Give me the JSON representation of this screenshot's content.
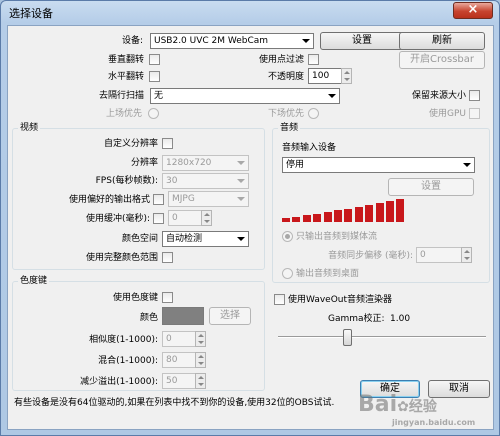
{
  "dialog": {
    "title": "选择设备",
    "close_label": "×"
  },
  "device": {
    "label": "设备:",
    "value": "USB2.0 UVC 2M WebCam",
    "config_button": "设置",
    "refresh_button": "刷新"
  },
  "flip_v": {
    "label": "垂直翻转"
  },
  "flip_h": {
    "label": "水平翻转"
  },
  "point_filter": {
    "label": "使用点过滤"
  },
  "opacity": {
    "label": "不透明度",
    "value": "100"
  },
  "crossbar_button": "开启Crossbar",
  "deinterlace": {
    "label": "去隔行扫描",
    "value": "无"
  },
  "keep_source_size": {
    "label": "保留来源大小"
  },
  "top_first": {
    "label": "上场优先"
  },
  "bottom_first": {
    "label": "下场优先"
  },
  "use_gpu": {
    "label": "使用GPU"
  },
  "video": {
    "group_label": "视频",
    "custom_resolution": {
      "label": "自定义分辨率"
    },
    "resolution": {
      "label": "分辨率",
      "value": "1280x720"
    },
    "fps": {
      "label": "FPS(每秒帧数):",
      "value": "30"
    },
    "preferred_format": {
      "label": "使用偏好的输出格式",
      "value": "MJPG"
    },
    "buffering": {
      "label": "使用缓冲(毫秒):",
      "value": "0"
    },
    "color_space": {
      "label": "颜色空间",
      "value": "自动检测"
    },
    "full_range": {
      "label": "使用完整颜色范围"
    }
  },
  "audio": {
    "group_label": "音频",
    "input_device_label": "音频输入设备",
    "input_device_value": "停用",
    "config_button": "设置",
    "meter_bars": [
      0.16,
      0.22,
      0.28,
      0.34,
      0.41,
      0.48,
      0.56,
      0.64,
      0.72,
      0.8,
      0.88,
      0.95
    ],
    "meter_color": "#c8171b",
    "output_stream_only": "只输出音频到媒体流",
    "sync_offset_label": "音频同步偏移 (毫秒):",
    "sync_offset_value": "0",
    "output_desktop": "输出音频到桌面"
  },
  "chroma": {
    "group_label": "色度键",
    "use_chroma": {
      "label": "使用色度键"
    },
    "color_label": "颜色",
    "color_value": "#808080",
    "select_button": "选择",
    "similarity": {
      "label": "相似度(1-1000):",
      "value": "0"
    },
    "blend": {
      "label": "混合(1-1000):",
      "value": "80"
    },
    "spill": {
      "label": "减少溢出(1-1000):",
      "value": "50"
    }
  },
  "waveout": {
    "label": "使用WaveOut音频渲染器"
  },
  "gamma": {
    "label": "Gamma校正:",
    "value": "1.00",
    "level": 0.33
  },
  "ok_button": "确定",
  "cancel_button": "取消",
  "footer_note": "有些设备是没有64位驱动的,如果在列表中找不到你的设备,使用32位的OBS试试.",
  "watermark": {
    "logo": "Bai",
    "suffix": "经验",
    "url": "jingyan.baidu.com"
  }
}
